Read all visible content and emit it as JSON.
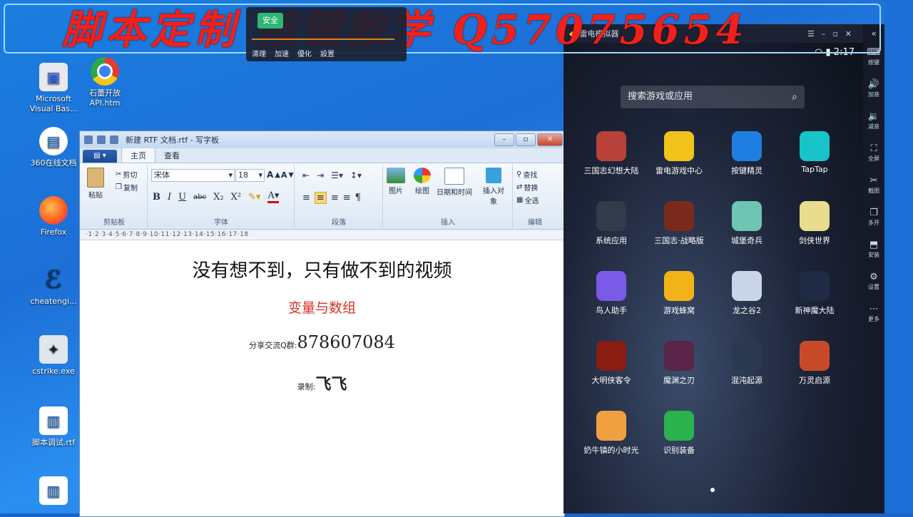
{
  "overlay": {
    "watermark": "脚本定制 按键教学 Q57075654"
  },
  "popup": {
    "safe_badge": "安全",
    "actions": [
      "清理",
      "加速",
      "優化",
      "設置"
    ]
  },
  "desktop": {
    "icons": [
      {
        "label": "Microsoft Visual Bas...",
        "icon": "visual-basic-icon"
      },
      {
        "label": "石蕾开放 API.htm",
        "icon": "chrome-icon"
      },
      {
        "label": "360在线文档",
        "icon": "document-icon"
      },
      {
        "label": "Firefox",
        "icon": "firefox-icon"
      },
      {
        "label": "cheatengi...",
        "icon": "cheat-engine-icon"
      },
      {
        "label": "cstrike.exe",
        "icon": "counter-strike-icon"
      },
      {
        "label": "脚本调试.rtf",
        "icon": "rtf-file-icon"
      }
    ]
  },
  "wordpad": {
    "title": "新建 RTF 文档.rtf - 写字板",
    "tabs": [
      "主页",
      "查看"
    ],
    "ribbon": {
      "clipboard": {
        "paste": "粘贴",
        "cut": "剪切",
        "copy": "复制",
        "label": "剪贴板"
      },
      "font": {
        "name": "宋体",
        "size": "18",
        "label": "字体"
      },
      "paragraph": {
        "label": "段落"
      },
      "insert": {
        "picture": "图片",
        "paint": "绘图",
        "datetime": "日期和时间",
        "object": "插入对象",
        "label": "插入"
      },
      "edit": {
        "find": "查找",
        "replace": "替换",
        "select_all": "全选",
        "label": "编辑"
      }
    },
    "ruler": "·1·2·3·4·5·6·7·8·9·10·11·12·13·14·15·16·17·18",
    "doc": {
      "line1": "没有想不到，只有做不到的视频",
      "line2": "变量与数组",
      "line3_prefix": "分享交流Q群:",
      "line3_num": "878607084",
      "line4_prefix": "录制:",
      "line4_name": "飞飞"
    }
  },
  "emulator": {
    "title": "雷电模拟器",
    "clock": "2:17",
    "search_placeholder": "搜索游戏或应用",
    "apps": [
      {
        "label": "三国志幻想大陆",
        "color": "#b8423a"
      },
      {
        "label": "雷电游戏中心",
        "color": "#f0c21b"
      },
      {
        "label": "按键精灵",
        "color": "#1e7fe0"
      },
      {
        "label": "TapTap",
        "color": "#17c4c9"
      },
      {
        "label": "系统应用",
        "color": "#333a4a"
      },
      {
        "label": "三国志·战略版",
        "color": "#7a2a1c"
      },
      {
        "label": "城堡奇兵",
        "color": "#6fc4b2"
      },
      {
        "label": "剑侠世界",
        "color": "#e8dc8e"
      },
      {
        "label": "鸟人助手",
        "color": "#7a5be8"
      },
      {
        "label": "游戏蜂窝",
        "color": "#f2b21a"
      },
      {
        "label": "龙之谷2",
        "color": "#c9d4e8"
      },
      {
        "label": "新神魔大陆",
        "color": "#1f2b44"
      },
      {
        "label": "大明侠客令",
        "color": "#8a1c14"
      },
      {
        "label": "魔渊之刃",
        "color": "#5a2448"
      },
      {
        "label": "混沌起源",
        "color": "#2a3850"
      },
      {
        "label": "万灵启源",
        "color": "#c84a2a"
      },
      {
        "label": "奶牛镇的小时光",
        "color": "#f0a040"
      },
      {
        "label": "识别装备",
        "color": "#2bb24c"
      }
    ],
    "sidebar": [
      "按键",
      "加音",
      "减音",
      "全屏",
      "截图",
      "多开",
      "安装",
      "设置",
      "更多"
    ]
  }
}
